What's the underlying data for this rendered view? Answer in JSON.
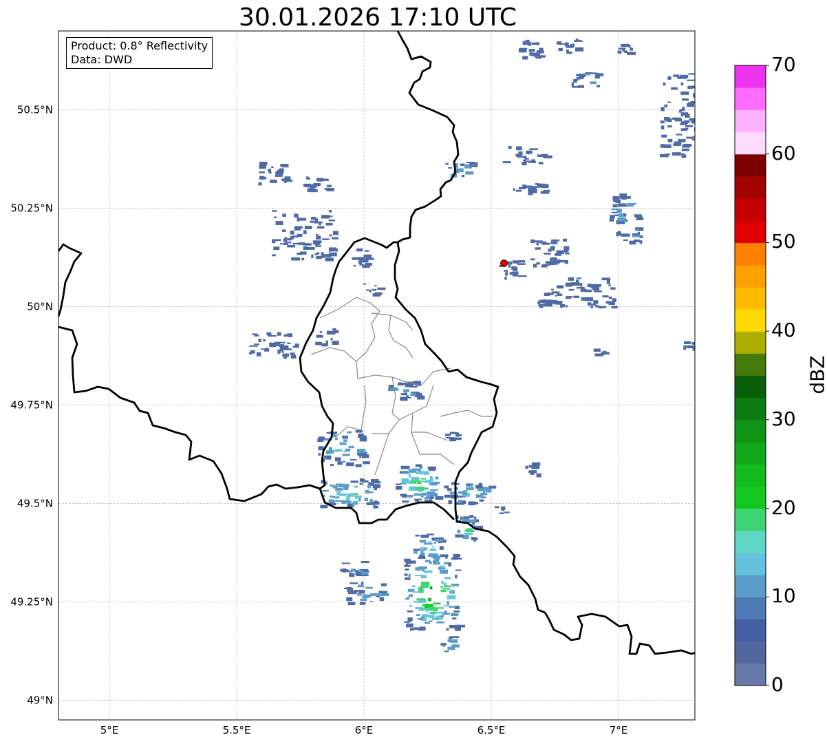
{
  "title": "30.01.2026 17:10 UTC",
  "info": {
    "product": "Product: 0.8° Reflectivity",
    "data": "Data: DWD"
  },
  "axes": {
    "lat_ticks": [
      "50.5°N",
      "50.25°N",
      "50°N",
      "49.75°N",
      "49.5°N",
      "49.25°N",
      "49°N"
    ],
    "lat_values": [
      50.5,
      50.25,
      50.0,
      49.75,
      49.5,
      49.25,
      49.0
    ],
    "lon_ticks": [
      "5°E",
      "5.5°E",
      "6°E",
      "6.5°E",
      "7°E"
    ],
    "lon_values": [
      5.0,
      5.5,
      6.0,
      6.5,
      7.0
    ],
    "lon_range": [
      4.8,
      7.3
    ],
    "lat_range": [
      48.95,
      50.7
    ],
    "grid": true
  },
  "radar_site": {
    "lon": 6.55,
    "lat": 50.11,
    "color": "#e00000"
  },
  "colorbar": {
    "label": "dBZ",
    "ticks": [
      "0",
      "10",
      "20",
      "30",
      "40",
      "50",
      "60",
      "70"
    ],
    "range": [
      0,
      70
    ],
    "colors": [
      "#6678a8",
      "#54679d",
      "#445fa3",
      "#4d7ab5",
      "#5a9dc8",
      "#66c1dc",
      "#60d6c4",
      "#3fd473",
      "#12c81e",
      "#12bb1c",
      "#10a718",
      "#0e9314",
      "#0a7c10",
      "#085f0a",
      "#447a0a",
      "#adad00",
      "#ffd900",
      "#ffbb00",
      "#ff9f00",
      "#ff7f00",
      "#e00000",
      "#c40000",
      "#a30000",
      "#7c0000",
      "#ffdcff",
      "#ffb0ff",
      "#ff6cff",
      "#ee33ee"
    ]
  },
  "echo_colors": [
    "#4e6aa7",
    "#5a9dc8",
    "#64c6d8",
    "#3fd473",
    "#12c81e",
    "#109b18"
  ]
}
